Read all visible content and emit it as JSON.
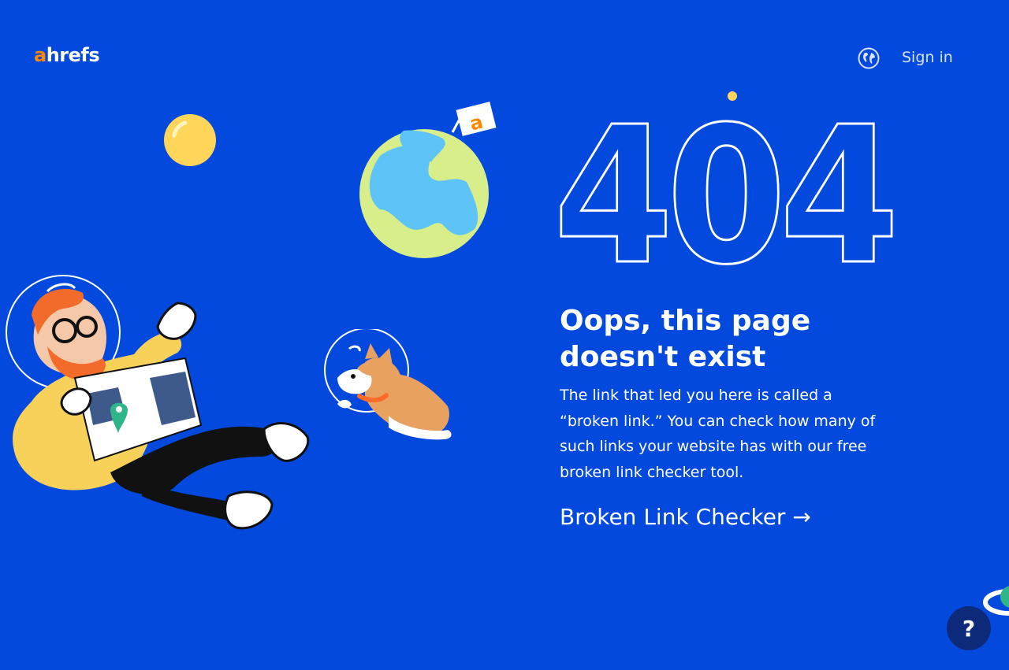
{
  "header": {
    "logo_accent": "a",
    "logo_rest": "hrefs",
    "signin_label": "Sign in"
  },
  "hero": {
    "code": "404",
    "title_line1": "Oops, this page",
    "title_line2": "doesn't exist",
    "description": "The link that led you here is called a “broken link.” You can check how many of such links your website has with our free broken link checker tool.",
    "cta_label": "Broken Link Checker →"
  },
  "illustration": {
    "flag_letter": "a"
  },
  "help": {
    "label": "?"
  },
  "colors": {
    "background": "#0449dd",
    "brand_accent": "#ff8800",
    "text": "#ffffff"
  },
  "icons": [
    "globe-icon",
    "question-icon",
    "arrow-right-icon"
  ]
}
